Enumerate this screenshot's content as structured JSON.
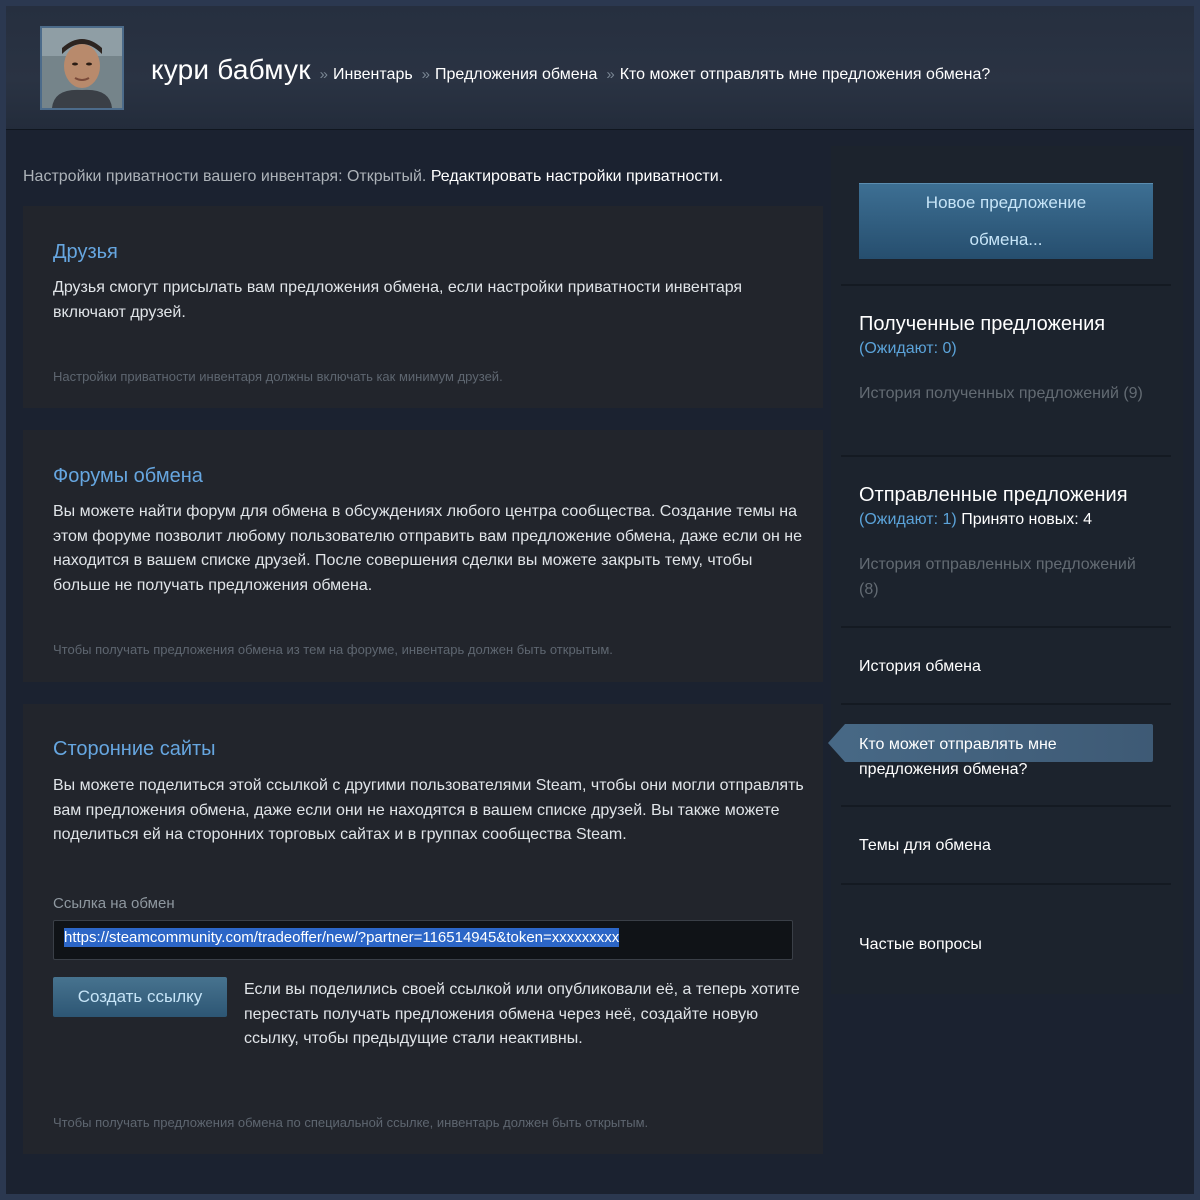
{
  "header": {
    "user_name": "кури бабмук",
    "breadcrumbs": [
      {
        "label": "Инвентарь"
      },
      {
        "label": "Предложения обмена"
      },
      {
        "label": "Кто может отправлять мне предложения обмена?"
      }
    ],
    "separator": "»"
  },
  "privacy": {
    "text": "Настройки приватности вашего инвентаря: Открытый.",
    "edit_link": "Редактировать настройки приватности."
  },
  "friends": {
    "title": "Друзья",
    "text": "Друзья смогут присылать вам предложения обмена, если настройки приватности инвентаря включают друзей.",
    "note": "Настройки приватности инвентаря должны включать как минимум друзей."
  },
  "forums": {
    "title": "Форумы обмена",
    "text": "Вы можете найти форум для обмена в обсуждениях любого центра сообщества. Создание темы на этом форуме позволит любому пользователю отправить вам предложение обмена, даже если он не находится в вашем списке друзей. После совершения сделки вы можете закрыть тему, чтобы больше не получать предложения обмена.",
    "note": "Чтобы получать предложения обмена из тем на форуме, инвентарь должен быть открытым."
  },
  "third_party": {
    "title": "Сторонние сайты",
    "text": "Вы можете поделиться этой ссылкой с другими пользователями Steam, чтобы они могли отправлять вам предложения обмена, даже если они не находятся в вашем списке друзей. Вы также можете поделиться ей на сторонних торговых сайтах и в группах сообщества Steam.",
    "link_label": "Ссылка на обмен",
    "link_value": "https://steamcommunity.com/tradeoffer/new/?partner=116514945&token=xxxxxxxxx",
    "create_button": "Создать ссылку",
    "create_desc": "Если вы поделились своей ссылкой или опубликовали её, а теперь хотите перестать получать предложения обмена через неё, создайте новую ссылку, чтобы предыдущие стали неактивны.",
    "note": "Чтобы получать предложения обмена по специальной ссылке, инвентарь должен быть открытым."
  },
  "sidebar": {
    "new_offer_line1": "Новое предложение",
    "new_offer_line2": "обмена...",
    "received_title": "Полученные предложения",
    "received_pending": "(Ожидают: 0)",
    "received_history": "История полученных предложений (9)",
    "sent_title": "Отправленные предложения",
    "sent_pending": "(Ожидают: 1)",
    "sent_accepted": "Принято новых: 4",
    "sent_history": "История отправленных предложений (8)",
    "trade_history": "История обмена",
    "who_can_send": "Кто может отправлять мне предложения обмена?",
    "trade_topics": "Темы для обмена",
    "faq": "Частые вопросы"
  },
  "colors": {
    "background": "#1b2838",
    "panel": "#22252c",
    "title_blue": "#66a6e0",
    "button": "#2d5674"
  }
}
